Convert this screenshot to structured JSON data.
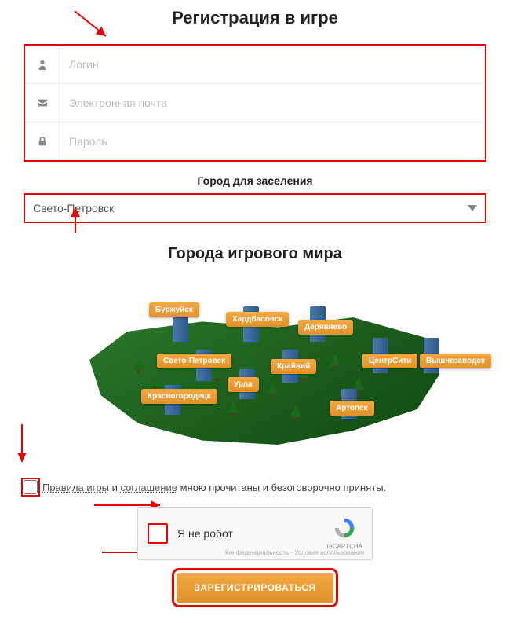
{
  "title": "Регистрация в игре",
  "form": {
    "login_placeholder": "Логин",
    "email_placeholder": "Электронная почта",
    "password_placeholder": "Пароль"
  },
  "city_section": {
    "label": "Город для заселения",
    "selected": "Свето-Петровск"
  },
  "map_section": {
    "title": "Города игрового мира",
    "cities": [
      {
        "name": "Буржуйск"
      },
      {
        "name": "Хардбасовск"
      },
      {
        "name": "Дерявяево"
      },
      {
        "name": "Свето-Петровск"
      },
      {
        "name": "Крайний"
      },
      {
        "name": "ЦентрСити"
      },
      {
        "name": "Вышнезаводск"
      },
      {
        "name": "Урла"
      },
      {
        "name": "Красногородецк"
      },
      {
        "name": "Артопск"
      }
    ]
  },
  "agreement": {
    "rules_link": "Правила игры",
    "connector1": " и ",
    "agreement_link": "соглашение",
    "suffix": " мною прочитаны и безоговорочно приняты."
  },
  "captcha": {
    "label": "Я не робот",
    "brand": "reCAPTCHA",
    "terms": "Конфиденциальность - Условия использования"
  },
  "submit_label": "ЗАРЕГИСТРИРОВАТЬСЯ"
}
